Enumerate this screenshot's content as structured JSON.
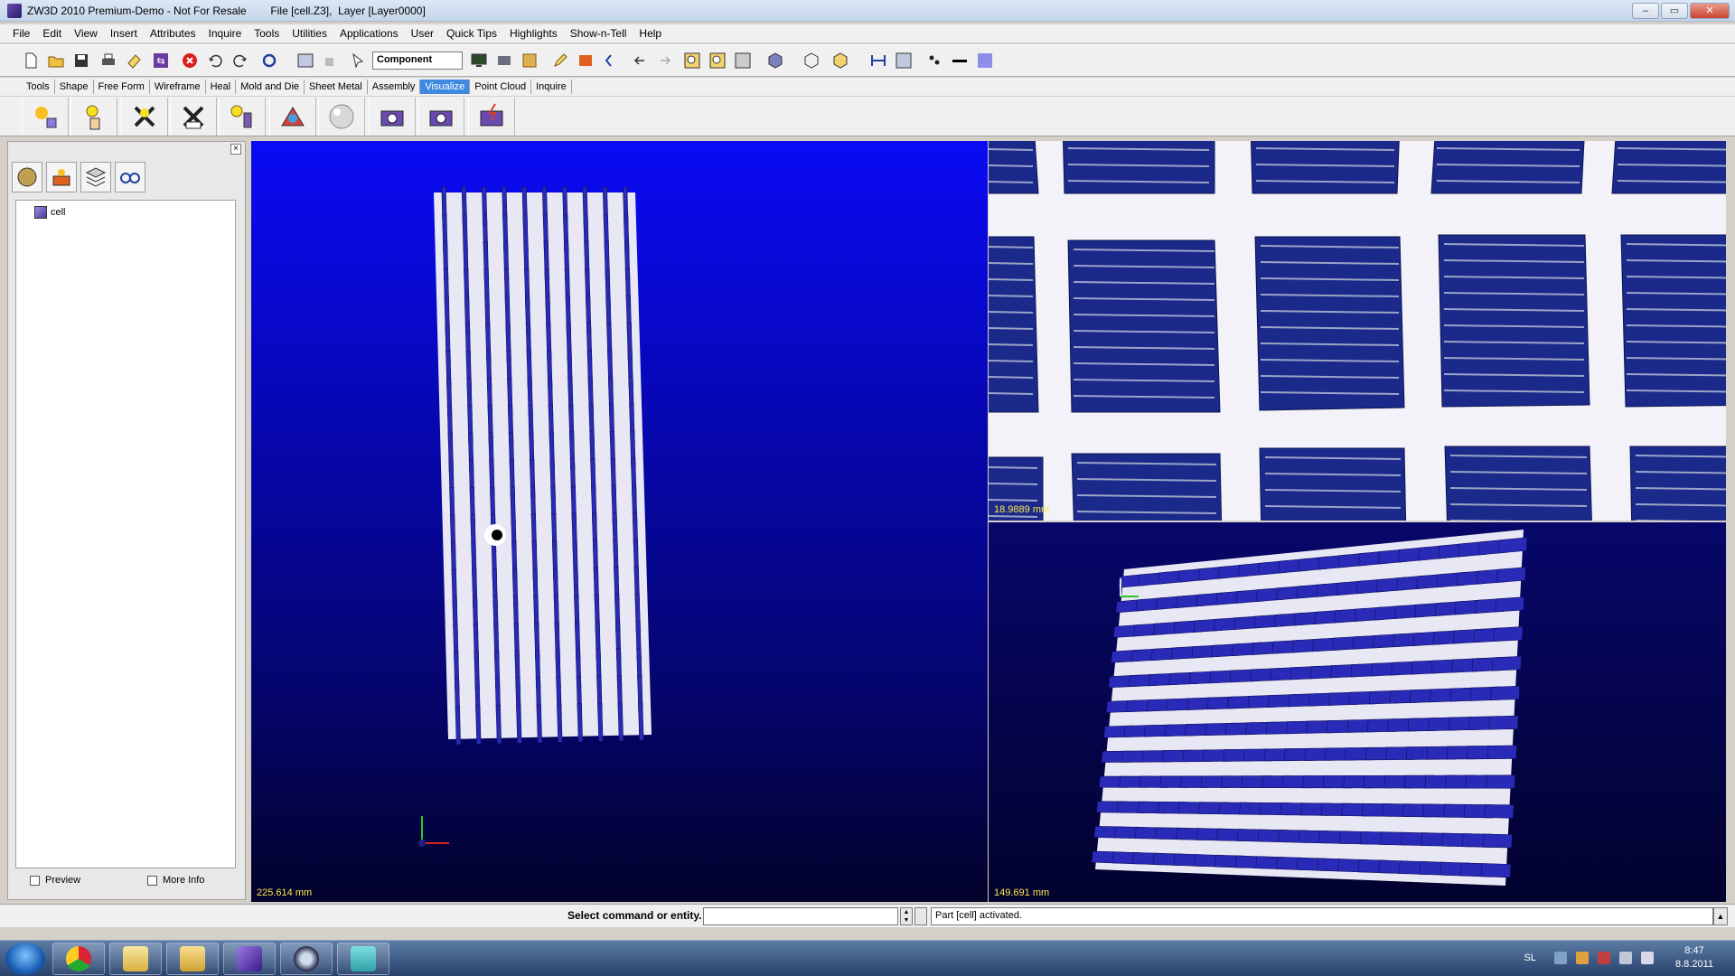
{
  "window": {
    "title": "ZW3D 2010 Premium-Demo - Not For Resale        File [cell.Z3],  Layer [Layer0000]",
    "controls": [
      "–",
      "▭",
      "✕"
    ]
  },
  "menubar": {
    "items": [
      "File",
      "Edit",
      "View",
      "Insert",
      "Attributes",
      "Inquire",
      "Tools",
      "Utilities",
      "Applications",
      "User",
      "Quick Tips",
      "Highlights",
      "Show-n-Tell",
      "Help"
    ]
  },
  "toolbar": {
    "component_value": "Component"
  },
  "ribbon_tabs": {
    "items": [
      "Tools",
      "Shape",
      "Free Form",
      "Wireframe",
      "Heal",
      "Mold and Die",
      "Sheet Metal",
      "Assembly",
      "Visualize",
      "Point Cloud",
      "Inquire"
    ],
    "active": "Visualize"
  },
  "left_panel": {
    "tree_root": "cell",
    "close_label": "×",
    "preview_label": "Preview",
    "more_info_label": "More Info"
  },
  "viewports": {
    "main_scale": "225.614 mm",
    "top_right_scale": "18.9889 mm",
    "bottom_right_scale": "149.691 mm"
  },
  "command_bar": {
    "prompt": "Select command or entity.",
    "message": "Part [cell] activated."
  },
  "taskbar": {
    "language": "SL",
    "time": "8:47",
    "date": "8.8.2011"
  },
  "colors": {
    "viewport_blue": "#0a0af5",
    "cell_blue": "#2a2ab8",
    "grid_white": "#e8e8f4",
    "scale_text": "#ffe84a",
    "active_tab": "#3f8ae0"
  }
}
